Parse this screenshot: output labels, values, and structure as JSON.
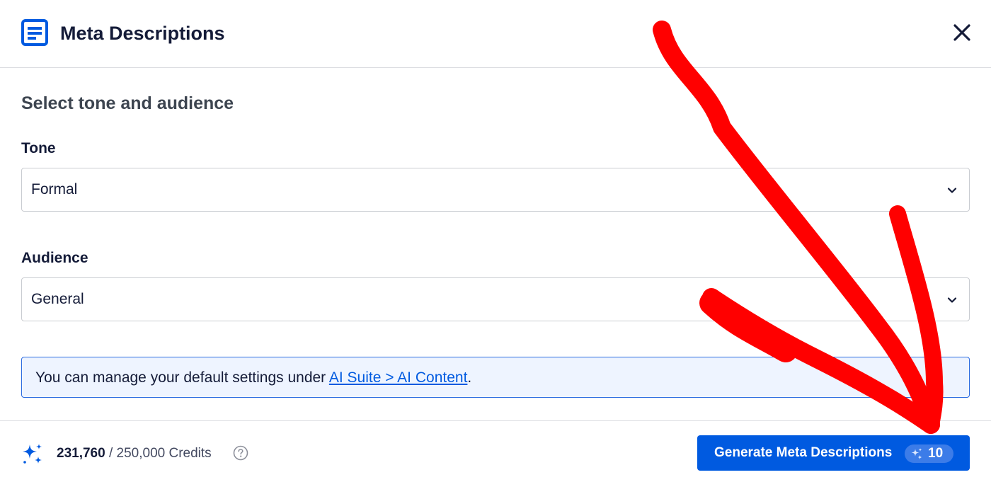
{
  "header": {
    "title": "Meta Descriptions",
    "icon": "document-lines-icon",
    "close_icon": "close-icon"
  },
  "form": {
    "section_title": "Select tone and audience",
    "tone": {
      "label": "Tone",
      "value": "Formal"
    },
    "audience": {
      "label": "Audience",
      "value": "General"
    }
  },
  "notice": {
    "text_before": "You can manage your default settings under ",
    "link_text": "AI Suite > AI Content",
    "text_after": "."
  },
  "footer": {
    "credits_used": "231,760",
    "credits_rest": " / 250,000 Credits",
    "generate_label": "Generate Meta Descriptions",
    "generate_cost": "10"
  },
  "colors": {
    "accent": "#005ae0",
    "annotation_arrow": "#ff0000"
  }
}
